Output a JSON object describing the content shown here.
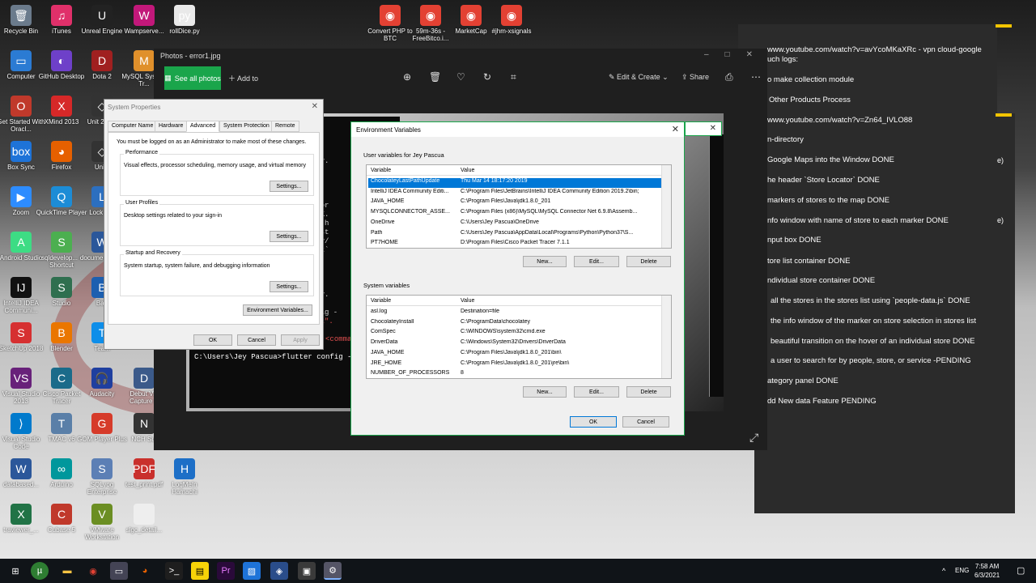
{
  "desktop": {
    "icons": [
      {
        "label": "Recycle Bin",
        "icon": "recycle-bin-icon",
        "color": "#6b7b8c",
        "glyph": "🗑"
      },
      {
        "label": "iTunes",
        "icon": "itunes-icon",
        "color": "#e0306a",
        "glyph": "♫"
      },
      {
        "label": "Unreal Engine",
        "icon": "unreal-engine-icon",
        "color": "#222",
        "glyph": "U"
      },
      {
        "label": "Wampserve...",
        "icon": "wampserver-icon",
        "color": "#c2187a",
        "glyph": "W"
      },
      {
        "label": "rollDice.py",
        "icon": "python-file-icon",
        "color": "#e9e9e9",
        "glyph": "py"
      },
      {
        "label": "Convert PHP to BTC",
        "icon": "chrome-icon",
        "color": "#e34133",
        "glyph": "◉"
      },
      {
        "label": "59m-36s - FreeBitco.i...",
        "icon": "chrome-icon",
        "color": "#e34133",
        "glyph": "◉"
      },
      {
        "label": "MarketCap",
        "icon": "chrome-icon",
        "color": "#e34133",
        "glyph": "◉"
      },
      {
        "label": "#⁠jhm-xsignals",
        "icon": "chrome-icon",
        "color": "#e34133",
        "glyph": "◉"
      },
      {
        "label": "Computer",
        "icon": "computer-icon",
        "color": "#2b7bd3",
        "glyph": "▭"
      },
      {
        "label": "GitHub Desktop",
        "icon": "github-icon",
        "color": "#6e40c9",
        "glyph": "◐"
      },
      {
        "label": "Dota 2",
        "icon": "dota-icon",
        "color": "#a02020",
        "glyph": "D"
      },
      {
        "label": "MySQL System Tr...",
        "icon": "mysql-icon",
        "color": "#e0902b",
        "glyph": "M"
      },
      {
        "label": "Get Started With Oracl...",
        "icon": "oracle-icon",
        "color": "#c0392b",
        "glyph": "O"
      },
      {
        "label": "XMind 2013",
        "icon": "xmind-icon",
        "color": "#d62828",
        "glyph": "X"
      },
      {
        "label": "Unit 2018.",
        "icon": "unity-icon",
        "color": "#333",
        "glyph": "◇"
      },
      {
        "label": "Box Sync",
        "icon": "box-icon",
        "color": "#1e73d8",
        "glyph": "box"
      },
      {
        "label": "Firefox",
        "icon": "firefox-icon",
        "color": "#e66000",
        "glyph": "◕"
      },
      {
        "label": "Unity",
        "icon": "unity-icon",
        "color": "#333",
        "glyph": "◇"
      },
      {
        "label": "Zoom",
        "icon": "zoom-icon",
        "color": "#2d8cff",
        "glyph": "▶"
      },
      {
        "label": "QuickTime Player",
        "icon": "quicktime-icon",
        "color": "#1c8cd6",
        "glyph": "Q"
      },
      {
        "label": "Lock Bro",
        "icon": "lock-icon",
        "color": "#2c6fbf",
        "glyph": "L"
      },
      {
        "label": "Android Studio",
        "icon": "android-studio-icon",
        "color": "#3ddc84",
        "glyph": "A"
      },
      {
        "label": "sqldevelop... - Shortcut",
        "icon": "sqldeveloper-icon",
        "color": "#4caf50",
        "glyph": "S"
      },
      {
        "label": "docume... Shor",
        "icon": "document-icon",
        "color": "#2b579a",
        "glyph": "W"
      },
      {
        "label": "IntelliJ IDEA Communi...",
        "icon": "intellij-icon",
        "color": "#111",
        "glyph": "IJ"
      },
      {
        "label": "Studio",
        "icon": "studio-icon",
        "color": "#2f6f4f",
        "glyph": "S"
      },
      {
        "label": "Batt",
        "icon": "battery-icon",
        "color": "#1d5fb0",
        "glyph": "B"
      },
      {
        "label": "SketchUp 2018",
        "icon": "sketchup-icon",
        "color": "#d63031",
        "glyph": "S"
      },
      {
        "label": "Blender",
        "icon": "blender-icon",
        "color": "#ea7600",
        "glyph": "B"
      },
      {
        "label": "Team",
        "icon": "teamviewer-icon",
        "color": "#0e8ee9",
        "glyph": "T"
      },
      {
        "label": "Visual Studio 2013",
        "icon": "visual-studio-icon",
        "color": "#68217a",
        "glyph": "VS"
      },
      {
        "label": "Cisco Packet Tracer",
        "icon": "cisco-icon",
        "color": "#1a6b8a",
        "glyph": "C"
      },
      {
        "label": "Audacity",
        "icon": "audacity-icon",
        "color": "#1f3f9f",
        "glyph": "🎧"
      },
      {
        "label": "Debut Vid Capture S",
        "icon": "debut-icon",
        "color": "#3b5a8a",
        "glyph": "D"
      },
      {
        "label": "Visual Studio Code",
        "icon": "vscode-icon",
        "color": "#007acc",
        "glyph": "⟩"
      },
      {
        "label": "TMAC v6",
        "icon": "tmac-icon",
        "color": "#5a7fa8",
        "glyph": "T"
      },
      {
        "label": "GOM Player Plus",
        "icon": "gom-player-icon",
        "color": "#d63b2a",
        "glyph": "G"
      },
      {
        "label": "NCH Sui",
        "icon": "nch-icon",
        "color": "#333",
        "glyph": "N"
      },
      {
        "label": "databased...",
        "icon": "word-icon",
        "color": "#2b579a",
        "glyph": "W"
      },
      {
        "label": "Arduino",
        "icon": "arduino-icon",
        "color": "#00979c",
        "glyph": "∞"
      },
      {
        "label": "SQLyog Enterprise",
        "icon": "sqlyog-icon",
        "color": "#5c7fb5",
        "glyph": "S"
      },
      {
        "label": "test_print.pdf",
        "icon": "pdf-icon",
        "color": "#c9302c",
        "glyph": "PDF"
      },
      {
        "label": "LogMeIn Hamachi",
        "icon": "hamachi-icon",
        "color": "#1d6fc7",
        "glyph": "H"
      },
      {
        "label": "traviewer_...",
        "icon": "excel-icon",
        "color": "#217346",
        "glyph": "X"
      },
      {
        "label": "Cubase 5",
        "icon": "cubase-icon",
        "color": "#c0392b",
        "glyph": "C"
      },
      {
        "label": "VMware Workstation",
        "icon": "vmware-icon",
        "color": "#6b8e23",
        "glyph": "V"
      },
      {
        "label": "slgc_detail...",
        "icon": "file-icon",
        "color": "#eee",
        "glyph": ""
      }
    ]
  },
  "notes": {
    "lines": [
      "www.youtube.com/watch?v=avYcoMKaXRc - vpn cloud-google",
      "uch logs:",
      "o make collection module",
      "Other Products Process",
      "www.youtube.com/watch?v=Zn64_IVLO88",
      "n-directory",
      "Google Maps into the Window DONE",
      "he header `Store Locator` DONE",
      "markers of stores to the map DONE",
      "nfo window with name of store to each marker DONE",
      "nput box DONE",
      "tore list container DONE",
      "ndividual store container DONE",
      "all the stores in the stores list using `people-data.js` DONE",
      "the info window of the marker on store selection in stores list",
      "beautiful transition on the hover of an individual store DONE",
      "a user to search for by people, store, or service -PENDING",
      "ategory panel DONE",
      "dd New data Feature PENDING"
    ],
    "side_fragments": [
      "e)",
      "e)"
    ]
  },
  "photos": {
    "title": "Photos - error1.jpg",
    "see_all": "See all photos",
    "add_to": "Add to",
    "edit_create": "Edit & Create",
    "share": "Share",
    "cmd_lines": [
      "ible)",
      "",
      "egory.",
      "",
      "ctor",
      "ails,",
      ".2.1,",
      "up for",
      "l SDK.",
      "rom: h",
      "assist",
      "r.dev/",
      "d-sdk`",
      "",
      "b)",
      "ible)",
      "",
      "egory.",
      "",
      "config -",
      "r sdk\".",
      "",
      "Run 'flutter -h' (or 'flutter <comma",
      "",
      "C:\\Users\\Jey Pascua>flutter config -"
    ]
  },
  "system_properties": {
    "title": "System Properties",
    "tabs": [
      "Computer Name",
      "Hardware",
      "Advanced",
      "System Protection",
      "Remote"
    ],
    "admin_note": "You must be logged on as an Administrator to make most of these changes.",
    "groups": [
      {
        "title": "Performance",
        "text": "Visual effects, processor scheduling, memory usage, and virtual memory",
        "button": "Settings..."
      },
      {
        "title": "User Profiles",
        "text": "Desktop settings related to your sign-in",
        "button": "Settings..."
      },
      {
        "title": "Startup and Recovery",
        "text": "System startup, system failure, and debugging information",
        "button": "Settings..."
      }
    ],
    "env_button": "Environment Variables...",
    "ok": "OK",
    "cancel": "Cancel",
    "apply": "Apply"
  },
  "environment_variables": {
    "title": "Environment Variables",
    "user_section": "User variables for Jey Pascua",
    "system_section": "System variables",
    "col_variable": "Variable",
    "col_value": "Value",
    "user_vars": [
      {
        "name": "ChocolateyLastPathUpdate",
        "value": "Thu Mar 14 18:17:20 2019"
      },
      {
        "name": "IntelliJ IDEA Community Editi...",
        "value": "C:\\Program Files\\JetBrains\\IntelliJ IDEA Community Edition 2019.2\\bin;"
      },
      {
        "name": "JAVA_HOME",
        "value": "C:\\Program Files\\Java\\jdk1.8.0_201"
      },
      {
        "name": "MYSQLCONNECTOR_ASSE...",
        "value": "C:\\Program Files (x86)\\MySQL\\MySQL Connector Net 6.9.8\\Assemb..."
      },
      {
        "name": "OneDrive",
        "value": "C:\\Users\\Jey Pascua\\OneDrive"
      },
      {
        "name": "Path",
        "value": "C:\\Users\\Jey Pascua\\AppData\\Local\\Programs\\Python\\Python37\\S..."
      },
      {
        "name": "PT7HOME",
        "value": "D:\\Program Files\\Cisco Packet Tracer 7.1.1"
      }
    ],
    "system_vars": [
      {
        "name": "asl.log",
        "value": "Destination=file"
      },
      {
        "name": "ChocolateyInstall",
        "value": "C:\\ProgramData\\chocolatey"
      },
      {
        "name": "ComSpec",
        "value": "C:\\WINDOWS\\system32\\cmd.exe"
      },
      {
        "name": "DriverData",
        "value": "C:\\Windows\\System32\\Drivers\\DriverData"
      },
      {
        "name": "JAVA_HOME",
        "value": "C:\\Program Files\\Java\\jdk1.8.0_201\\bin\\"
      },
      {
        "name": "JRE_HOME",
        "value": "C:\\Program Files\\Java\\jdk1.8.0_201\\jre\\bin\\"
      },
      {
        "name": "NUMBER_OF_PROCESSORS",
        "value": "8"
      }
    ],
    "new": "New...",
    "edit": "Edit...",
    "delete": "Delete",
    "ok": "OK",
    "cancel": "Cancel"
  },
  "taskbar": {
    "lang": "ENG",
    "time": "7:58 AM",
    "date": "6/3/2021"
  }
}
